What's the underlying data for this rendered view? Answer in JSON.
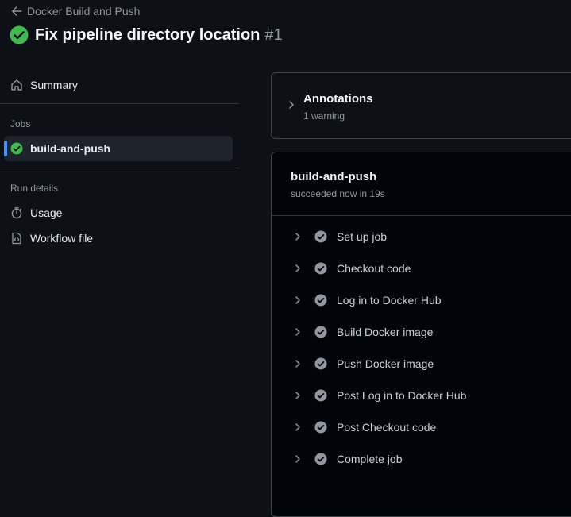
{
  "header": {
    "back_label": "Docker Build and Push",
    "title": "Fix pipeline directory location",
    "run_number": "#1"
  },
  "sidebar": {
    "summary_label": "Summary",
    "jobs_heading": "Jobs",
    "job_item_label": "build-and-push",
    "run_details_heading": "Run details",
    "usage_label": "Usage",
    "workflow_file_label": "Workflow file"
  },
  "annotations": {
    "title": "Annotations",
    "subtitle": "1 warning"
  },
  "job": {
    "title": "build-and-push",
    "status": "succeeded now in 19s",
    "steps": [
      {
        "label": "Set up job"
      },
      {
        "label": "Checkout code"
      },
      {
        "label": "Log in to Docker Hub"
      },
      {
        "label": "Build Docker image"
      },
      {
        "label": "Push Docker image"
      },
      {
        "label": "Post Log in to Docker Hub"
      },
      {
        "label": "Post Checkout code"
      },
      {
        "label": "Complete job"
      }
    ]
  },
  "colors": {
    "success": "#3fb950",
    "step_check": "#9198a1",
    "accent": "#4493f8"
  }
}
